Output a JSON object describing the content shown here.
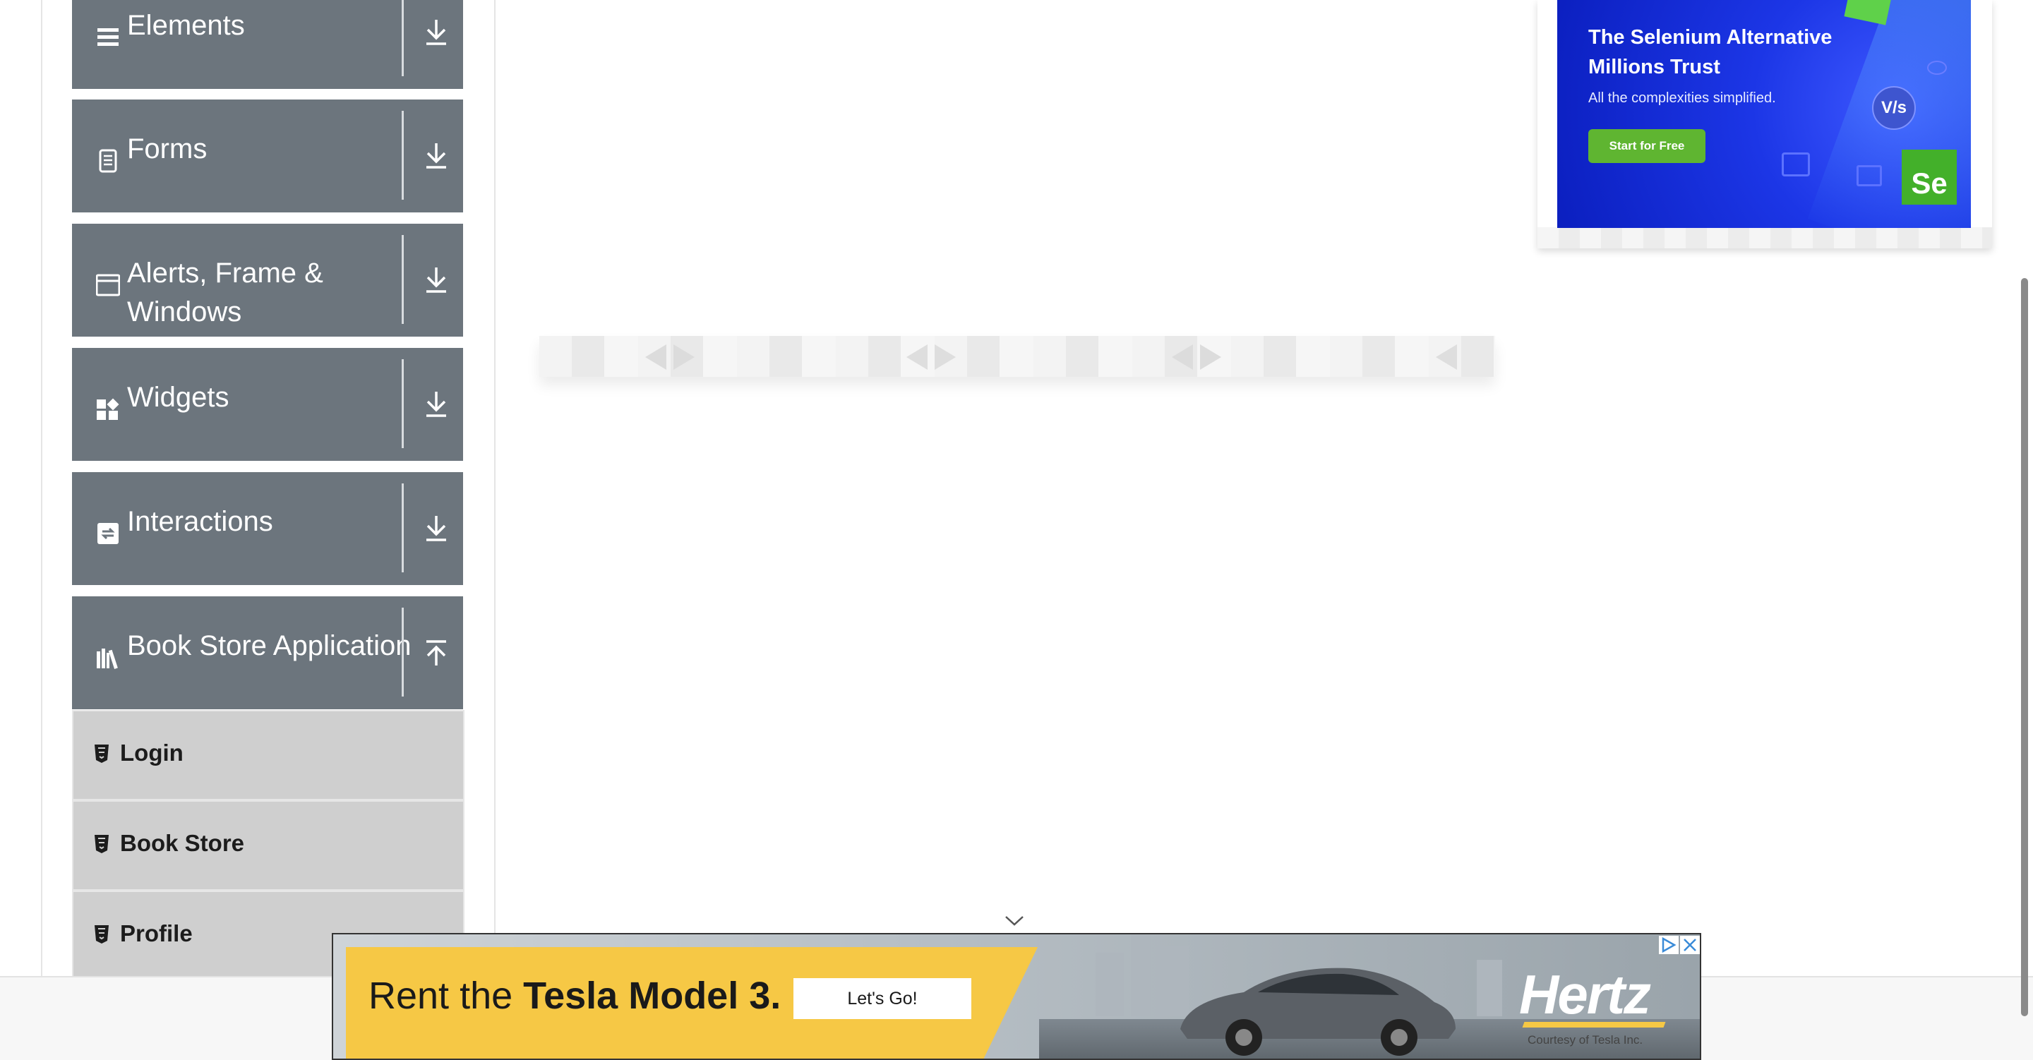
{
  "sidebar": {
    "groups": [
      {
        "label": "Elements",
        "icon": "hamburger-list-icon",
        "expanded": false
      },
      {
        "label": "Forms",
        "icon": "document-icon",
        "expanded": false
      },
      {
        "label": "Alerts, Frame & Windows",
        "label_line1": "Alerts, Frame &",
        "label_line2": "Windows",
        "icon": "window-icon",
        "expanded": false
      },
      {
        "label": "Widgets",
        "icon": "widgets-icon",
        "expanded": false
      },
      {
        "label": "Interactions",
        "icon": "interactions-icon",
        "expanded": false
      },
      {
        "label": "Book Store Application",
        "icon": "books-icon",
        "expanded": true
      }
    ],
    "book_store_items": [
      {
        "label": "Login",
        "icon": "html5-shield-icon"
      },
      {
        "label": "Book Store",
        "icon": "html5-shield-icon"
      },
      {
        "label": "Profile",
        "icon": "html5-shield-icon"
      }
    ]
  },
  "ad_top_right": {
    "headline_line1": "The Selenium Alternative",
    "headline_line2": "Millions Trust",
    "subtext": "All the complexities simplified.",
    "button": "Start for Free",
    "badge_vs": "V/s",
    "badge_se": "Se"
  },
  "ad_banner": {
    "headline_prefix": "Rent the ",
    "headline_bold": "Tesla Model 3.",
    "cta": "Let's Go!",
    "brand": "Hertz",
    "courtesy": "Courtesy of Tesla Inc."
  },
  "colors": {
    "sidebar_group_bg": "#6c757d",
    "sidebar_sub_bg": "#cfcfcf",
    "ad_blue": "#1c36e6",
    "ad_green": "#5fb531",
    "banner_yellow": "#f6c845"
  }
}
